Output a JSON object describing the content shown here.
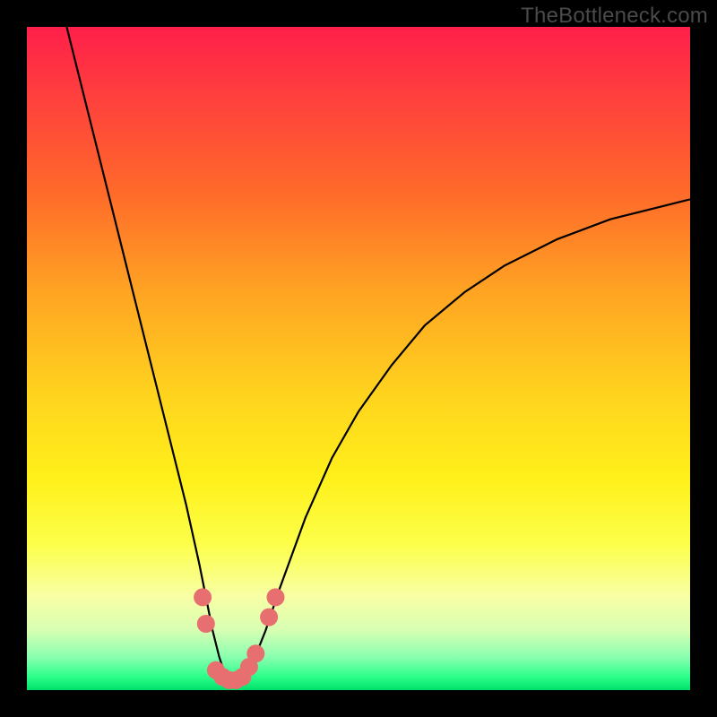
{
  "watermark": "TheBottleneck.com",
  "chart_data": {
    "type": "line",
    "title": "",
    "xlabel": "",
    "ylabel": "",
    "xlim": [
      0,
      100
    ],
    "ylim": [
      0,
      100
    ],
    "series": [
      {
        "name": "bottleneck-curve",
        "x": [
          6,
          8,
          10,
          12,
          14,
          16,
          18,
          20,
          22,
          24,
          26,
          27,
          28,
          29,
          30,
          31,
          32,
          33,
          34,
          36,
          38,
          42,
          46,
          50,
          55,
          60,
          66,
          72,
          80,
          88,
          96,
          100
        ],
        "y": [
          100,
          92,
          84,
          76,
          68,
          60,
          52,
          44,
          36,
          28,
          19,
          14,
          9,
          5,
          2,
          1,
          1,
          2,
          4,
          9,
          15,
          26,
          35,
          42,
          49,
          55,
          60,
          64,
          68,
          71,
          73,
          74
        ]
      }
    ],
    "markers": [
      {
        "name": "cluster-left",
        "x": 26.5,
        "y": 14
      },
      {
        "name": "cluster-left",
        "x": 27.0,
        "y": 10
      },
      {
        "name": "cluster-bottom",
        "x": 28.5,
        "y": 3
      },
      {
        "name": "cluster-bottom",
        "x": 29.5,
        "y": 2
      },
      {
        "name": "cluster-bottom",
        "x": 30.5,
        "y": 1.5
      },
      {
        "name": "cluster-bottom",
        "x": 31.5,
        "y": 1.5
      },
      {
        "name": "cluster-bottom",
        "x": 32.5,
        "y": 2
      },
      {
        "name": "cluster-bottom",
        "x": 33.5,
        "y": 3.5
      },
      {
        "name": "cluster-bottom",
        "x": 34.5,
        "y": 5.5
      },
      {
        "name": "cluster-right",
        "x": 36.5,
        "y": 11
      },
      {
        "name": "cluster-right",
        "x": 37.5,
        "y": 14
      }
    ],
    "gradient_stops": [
      {
        "pos": 0.0,
        "color": "#ff1f4a"
      },
      {
        "pos": 0.25,
        "color": "#ff6a2a"
      },
      {
        "pos": 0.55,
        "color": "#ffd21e"
      },
      {
        "pos": 0.78,
        "color": "#fcff4a"
      },
      {
        "pos": 0.95,
        "color": "#8affb0"
      },
      {
        "pos": 1.0,
        "color": "#00e06a"
      }
    ],
    "marker_color": "#e76f6f",
    "curve_color": "#000000"
  }
}
